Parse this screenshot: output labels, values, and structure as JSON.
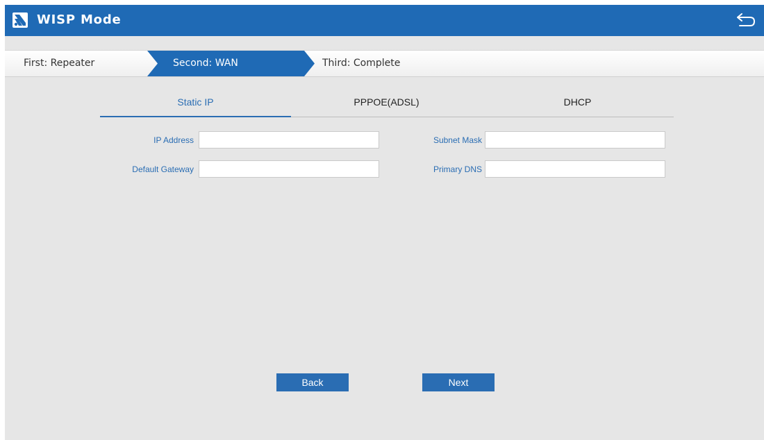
{
  "titlebar": {
    "title": "WISP Mode",
    "icon": "wisp-logo-icon",
    "back_icon": "return-arrow-icon",
    "color": "#1f6ab5"
  },
  "steps": [
    {
      "label": "First: Repeater",
      "active": false
    },
    {
      "label": "Second: WAN",
      "active": true
    },
    {
      "label": "Third: Complete",
      "active": false
    }
  ],
  "tabs": [
    {
      "label": "Static IP",
      "active": true
    },
    {
      "label": "PPPOE(ADSL)",
      "active": false
    },
    {
      "label": "DHCP",
      "active": false
    }
  ],
  "form": {
    "ip_address": {
      "label": "IP Address",
      "value": ""
    },
    "subnet_mask": {
      "label": "Subnet Mask",
      "value": ""
    },
    "default_gateway": {
      "label": "Default Gateway",
      "value": ""
    },
    "primary_dns": {
      "label": "Primary DNS",
      "value": ""
    }
  },
  "buttons": {
    "back": "Back",
    "next": "Next"
  },
  "colors": {
    "accent": "#2a6db3",
    "background": "#e6e6e6"
  }
}
